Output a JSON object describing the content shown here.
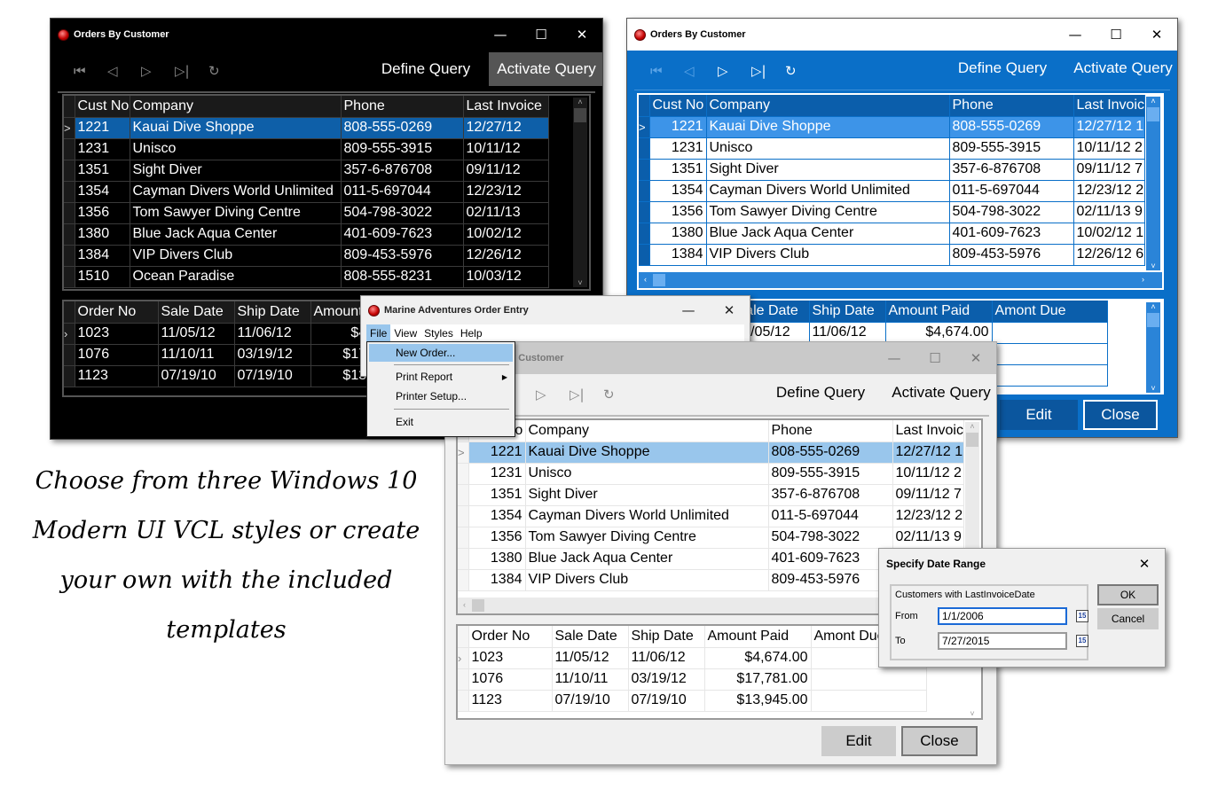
{
  "caption": [
    "Choose from three Windows 10",
    "Modern UI VCL styles or create",
    "your own with the included templates"
  ],
  "window_title": "Orders By Customer",
  "nav_icons": {
    "first": "⏮",
    "prev": "◁",
    "next": "▷",
    "last": "▷|",
    "refresh": "↻"
  },
  "caption_buttons": {
    "minimize": "—",
    "maximize": "☐",
    "close": "✕"
  },
  "define_query": "Define Query",
  "activate_query": "Activate Query",
  "customers": {
    "columns": [
      "Cust No",
      "Company",
      "Phone",
      "Last Invoice"
    ],
    "rows": [
      [
        "1221",
        "Kauai Dive Shoppe",
        "808-555-0269",
        "12/27/12"
      ],
      [
        "1231",
        "Unisco",
        "809-555-3915",
        "10/11/12"
      ],
      [
        "1351",
        "Sight Diver",
        "357-6-876708",
        "09/11/12"
      ],
      [
        "1354",
        "Cayman Divers World Unlimited",
        "011-5-697044",
        "12/23/12"
      ],
      [
        "1356",
        "Tom Sawyer Diving Centre",
        "504-798-3022",
        "02/11/13"
      ],
      [
        "1380",
        "Blue Jack Aqua Center",
        "401-609-7623",
        "10/02/12"
      ],
      [
        "1384",
        "VIP Divers Club",
        "809-453-5976",
        "12/26/12"
      ],
      [
        "1510",
        "Ocean Paradise",
        "808-555-8231",
        "10/03/12"
      ]
    ],
    "truncated_invoice_suffix": [
      "1",
      "2",
      "7",
      "2",
      "9",
      "1",
      "6"
    ]
  },
  "orders": {
    "columns": [
      "Order No",
      "Sale Date",
      "Ship Date",
      "Amount Paid",
      "Amont Due"
    ],
    "rows": [
      [
        "1023",
        "11/05/12",
        "11/06/12",
        "$4,674.00",
        ""
      ],
      [
        "1076",
        "11/10/11",
        "03/19/12",
        "$17,781.00",
        ""
      ],
      [
        "1123",
        "07/19/10",
        "07/19/10",
        "$13,945.00",
        ""
      ]
    ]
  },
  "edit": "Edit",
  "close": "Close",
  "row_indicator": ">",
  "menu_window": {
    "title": "Marine Adventures Order Entry",
    "menus": [
      "File",
      "View",
      "Styles",
      "Help"
    ],
    "file_items": [
      "New Order...",
      "Print Report",
      "Printer Setup...",
      "Exit"
    ]
  },
  "date_dialog": {
    "title": "Specify Date Range",
    "group_label": "Customers with LastInvoiceDate",
    "from_label": "From",
    "from_value": "1/1/2006",
    "to_label": "To",
    "to_value": "7/27/2015",
    "calendar_glyph": "15",
    "ok": "OK",
    "cancel": "Cancel"
  },
  "colors": {
    "dark_bg": "#000000",
    "blue_accent": "#0a6fc8",
    "selection_light": "#99c6ec",
    "selection_dark": "#0e5fa8"
  }
}
